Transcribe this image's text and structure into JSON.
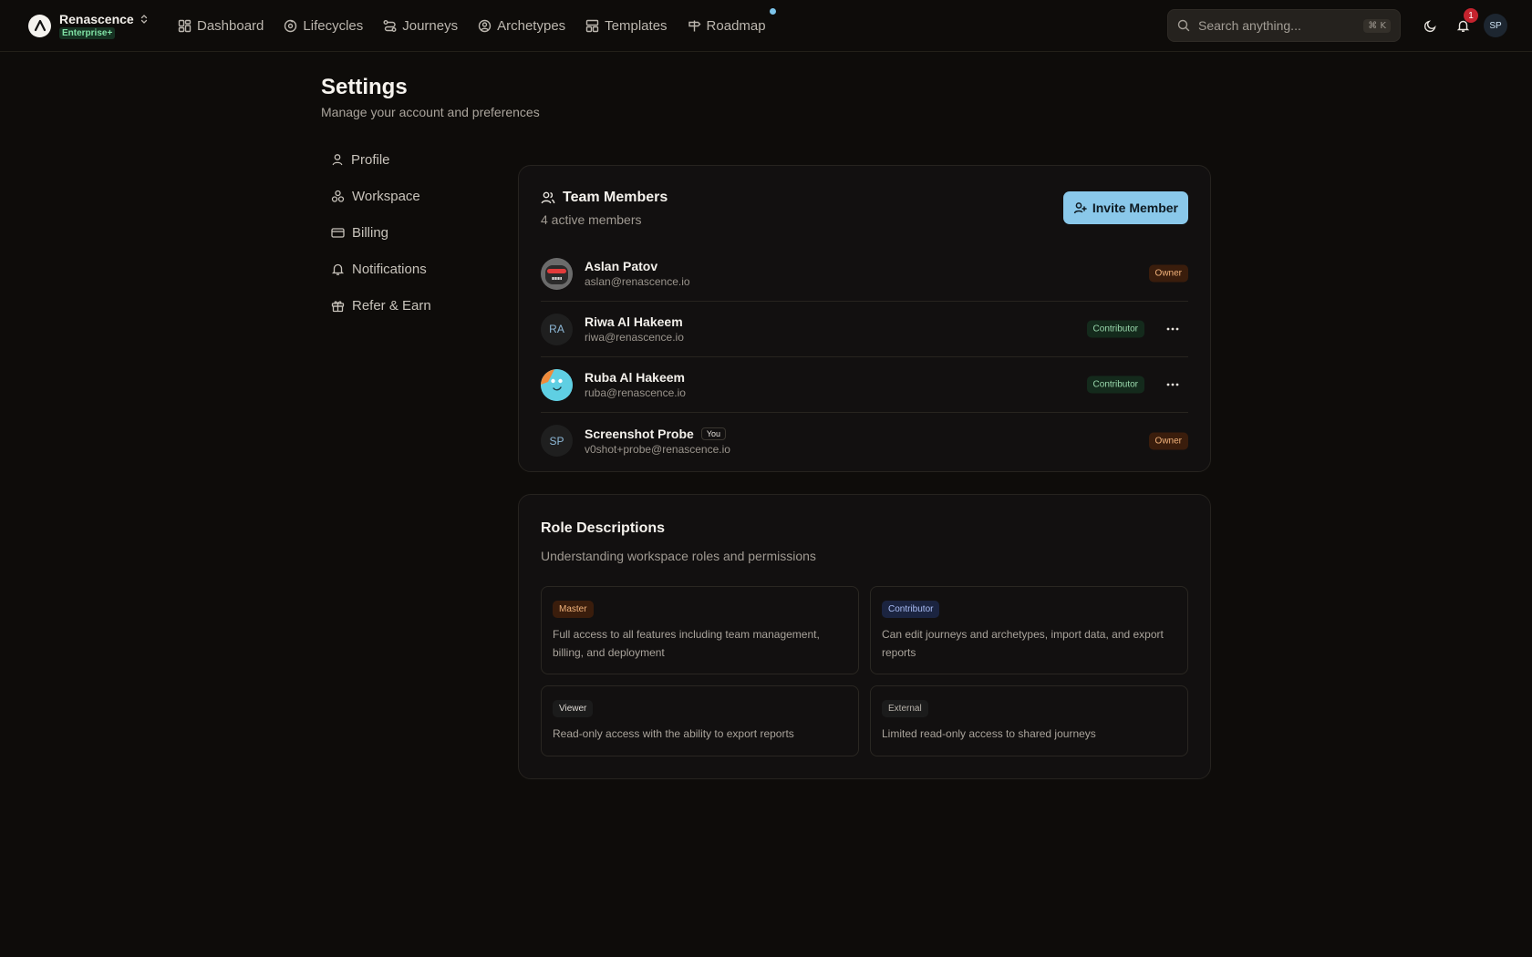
{
  "brand": {
    "name": "Renascence",
    "plan": "Enterprise+"
  },
  "nav": [
    {
      "label": "Dashboard",
      "icon": "grid-icon"
    },
    {
      "label": "Lifecycles",
      "icon": "cycle-icon"
    },
    {
      "label": "Journeys",
      "icon": "route-icon"
    },
    {
      "label": "Archetypes",
      "icon": "user-circle-icon"
    },
    {
      "label": "Templates",
      "icon": "layout-icon"
    },
    {
      "label": "Roadmap",
      "icon": "signpost-icon"
    }
  ],
  "search": {
    "placeholder": "Search anything...",
    "shortcut": "⌘ K"
  },
  "notifications": {
    "count": "1"
  },
  "user": {
    "initials": "SP"
  },
  "page": {
    "title": "Settings",
    "subtitle": "Manage your account and preferences"
  },
  "side_menu": [
    {
      "label": "Profile",
      "icon": "user-icon"
    },
    {
      "label": "Workspace",
      "icon": "workspace-icon"
    },
    {
      "label": "Billing",
      "icon": "credit-card-icon"
    },
    {
      "label": "Notifications",
      "icon": "bell-icon"
    },
    {
      "label": "Refer & Earn",
      "icon": "gift-icon"
    }
  ],
  "team": {
    "title": "Team Members",
    "subtitle": "4 active members",
    "invite_label": "Invite Member",
    "members": [
      {
        "name": "Aslan Patov",
        "email": "aslan@renascence.io",
        "role": "Owner",
        "avatar": "image",
        "you": false
      },
      {
        "name": "Riwa Al Hakeem",
        "email": "riwa@renascence.io",
        "role": "Contributor",
        "avatar": "RA",
        "you": false
      },
      {
        "name": "Ruba Al Hakeem",
        "email": "ruba@renascence.io",
        "role": "Contributor",
        "avatar": "image",
        "you": false
      },
      {
        "name": "Screenshot Probe",
        "email": "v0shot+probe@renascence.io",
        "role": "Owner",
        "avatar": "SP",
        "you": true,
        "you_label": "You"
      }
    ]
  },
  "roles": {
    "title": "Role Descriptions",
    "subtitle": "Understanding workspace roles and permissions",
    "items": [
      {
        "name": "Master",
        "description": "Full access to all features including team management, billing, and deployment"
      },
      {
        "name": "Contributor",
        "description": "Can edit journeys and archetypes, import data, and export reports"
      },
      {
        "name": "Viewer",
        "description": "Read-only access with the ability to export reports"
      },
      {
        "name": "External",
        "description": "Limited read-only access to shared journeys"
      }
    ]
  },
  "colors": {
    "background": "#0e0c0a",
    "accent": "#8ac8ea",
    "owner_badge": "#3a1d0c",
    "contributor_badge": "#142a1c",
    "notification_badge": "#c4232e"
  }
}
